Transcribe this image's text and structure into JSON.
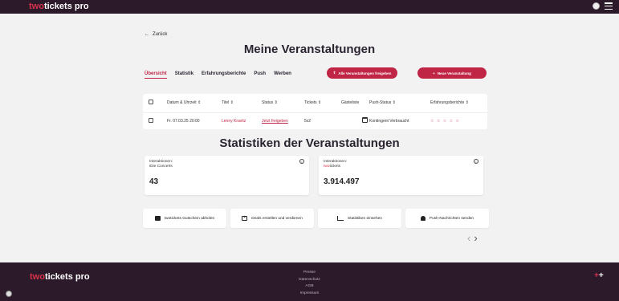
{
  "header": {
    "brand_prefix": "two",
    "brand_suffix": "tickets pro"
  },
  "nav": {
    "back_label": "Zurück"
  },
  "page": {
    "title": "Meine Veranstaltungen"
  },
  "tabs": [
    {
      "label": "Übersicht",
      "active": true
    },
    {
      "label": "Statistik"
    },
    {
      "label": "Erfahrungsberichte"
    },
    {
      "label": "Push"
    },
    {
      "label": "Werben"
    }
  ],
  "buttons": {
    "release_all": "Alle Veranstaltungen freigeben",
    "new_event": "Neue Veranstaltung"
  },
  "table": {
    "headers": [
      "Datum & Uhrzeit ⇕",
      "Titel ⇕",
      "Status ⇕",
      "Tickets ⇕",
      "Gästeliste",
      "Push-Status ⇕",
      "Erfahrungsberichte ⇕"
    ],
    "rows": [
      {
        "date": "Fr. 07.03.25 20:00",
        "title": "Lenny Kravitz",
        "status": "Jetzt freigeben",
        "tickets": "5x2",
        "push_status": "Kontingent Verbraucht",
        "rating": "☆ ☆ ☆ ☆ ☆"
      }
    ]
  },
  "stats": {
    "title": "Statistiken der Veranstaltungen",
    "cards": [
      {
        "label": "Interaktionen:",
        "sub": "iDie Concerts",
        "value": "43"
      },
      {
        "label": "Interaktionen:",
        "sub_prefix": "two",
        "sub_suffix": "tickets",
        "value": "3.914.497"
      }
    ]
  },
  "actions": [
    {
      "label": "twotickets Gutschein abholen",
      "icon": "ticket-icon"
    },
    {
      "label": "Deals erstellen und verdienen",
      "icon": "add-box-icon"
    },
    {
      "label": "Statistiken einsehen",
      "icon": "chart-icon"
    },
    {
      "label": "Push-Nachrichten senden",
      "icon": "bell-icon"
    }
  ],
  "pager": {
    "prev": "‹",
    "next": "›"
  },
  "footer": {
    "brand_prefix": "two",
    "brand_suffix": "tickets pro",
    "links": [
      "Presse",
      "Datenschutz",
      "AGB",
      "Impressum"
    ]
  },
  "colors": {
    "accent": "#c02545",
    "header_bg": "#2c1a2a",
    "page_bg": "#f2f2f3"
  }
}
